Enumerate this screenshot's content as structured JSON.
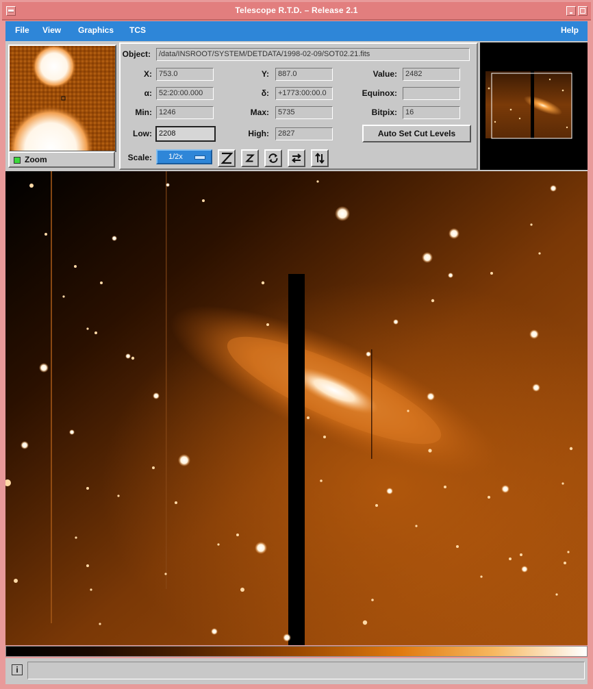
{
  "window": {
    "title": "Telescope R.T.D. – Release 2.1"
  },
  "menu": {
    "file": "File",
    "view": "View",
    "graphics": "Graphics",
    "tcs": "TCS",
    "help": "Help"
  },
  "zoom": {
    "label": "Zoom"
  },
  "info": {
    "object_label": "Object:",
    "object_value": "/data/INSROOT/SYSTEM/DETDATA/1998-02-09/SOT02.21.fits",
    "x_label": "X:",
    "x_value": "753.0",
    "y_label": "Y:",
    "y_value": "887.0",
    "value_label": "Value:",
    "value_value": "2482",
    "alpha_label": "α:",
    "alpha_value": "52:20:00.000",
    "delta_label": "δ:",
    "delta_value": "+1773:00:00.0",
    "equinox_label": "Equinox:",
    "equinox_value": "",
    "min_label": "Min:",
    "min_value": "1246",
    "max_label": "Max:",
    "max_value": "5735",
    "bitpix_label": "Bitpix:",
    "bitpix_value": "16",
    "low_label": "Low:",
    "low_value": "2208",
    "high_label": "High:",
    "high_value": "2827",
    "autoset_label": "Auto Set Cut Levels",
    "scale_label": "Scale:",
    "scale_value": "1/2x"
  },
  "toolbar": {
    "zscale_big_icon": "Z-icon",
    "zscale_small_icon": "z-icon",
    "rotate_icon": "rotate-icon",
    "flip_x_icon": "flip-horizontal-icon",
    "flip_y_icon": "flip-vertical-icon"
  },
  "colors": {
    "accent": "#2e86d8",
    "title_bar": "#e27e7e",
    "panel": "#c8c8c8"
  }
}
